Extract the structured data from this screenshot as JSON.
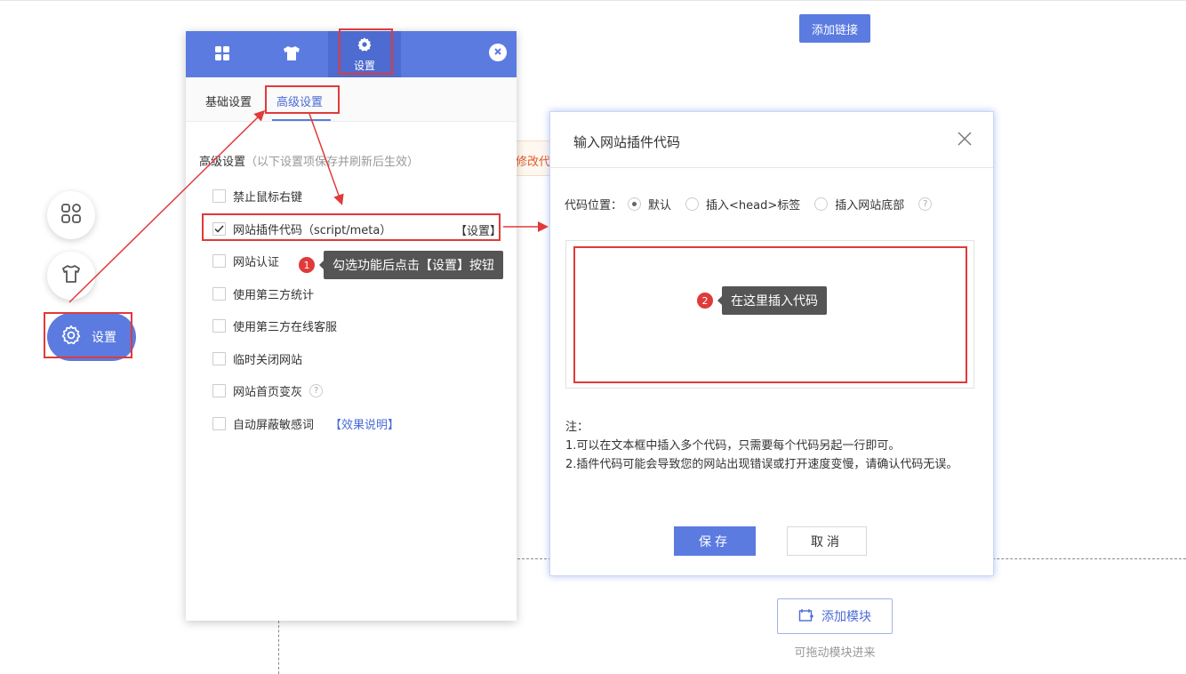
{
  "canvas": {
    "add_link_label": "添加链接",
    "notice_text": "修改代",
    "add_module_label": "添加模块",
    "drag_hint": "可拖动模块进来"
  },
  "float_tools": {
    "modules_icon": "grid-icon",
    "theme_icon": "tshirt-icon",
    "settings_label": "设置"
  },
  "panel": {
    "tabs": [
      {
        "icon": "grid-icon"
      },
      {
        "icon": "tshirt-icon"
      },
      {
        "icon": "gear-icon",
        "label": "设置"
      }
    ],
    "subtabs": [
      "基础设置",
      "高级设置"
    ],
    "section_title": "高级设置",
    "section_note": "（以下设置项保存并刷新后生效）",
    "options": [
      {
        "label": "禁止鼠标右键",
        "checked": false
      },
      {
        "label": "网站插件代码（script/meta）",
        "checked": true,
        "action": "【设置】"
      },
      {
        "label": "网站认证",
        "checked": false
      },
      {
        "label": "使用第三方统计",
        "checked": false
      },
      {
        "label": "使用第三方在线客服",
        "checked": false
      },
      {
        "label": "临时关闭网站",
        "checked": false
      },
      {
        "label": "网站首页变灰",
        "checked": false,
        "help": "?"
      },
      {
        "label": "自动屏蔽敏感词",
        "checked": false,
        "link": "【效果说明】"
      }
    ]
  },
  "dialog": {
    "title": "输入网站插件代码",
    "position_label": "代码位置：",
    "position_options": [
      "默认",
      "插入<head>标签",
      "插入网站底部"
    ],
    "selected_position": "默认",
    "help": "?",
    "code_value": "",
    "notes_title": "注：",
    "notes": [
      "1.可以在文本框中插入多个代码，只需要每个代码另起一行即可。",
      "2.插件代码可能会导致您的网站出现错误或打开速度变慢，请确认代码无误。"
    ],
    "save_label": "保存",
    "cancel_label": "取消"
  },
  "annotations": {
    "step1_num": "1",
    "step1_text": "勾选功能后点击【设置】按钮",
    "step2_num": "2",
    "step2_text": "在这里插入代码",
    "highlight_color": "#e03a3a"
  },
  "colors": {
    "brand": "#5b7be0",
    "link": "#4a6bd6"
  }
}
